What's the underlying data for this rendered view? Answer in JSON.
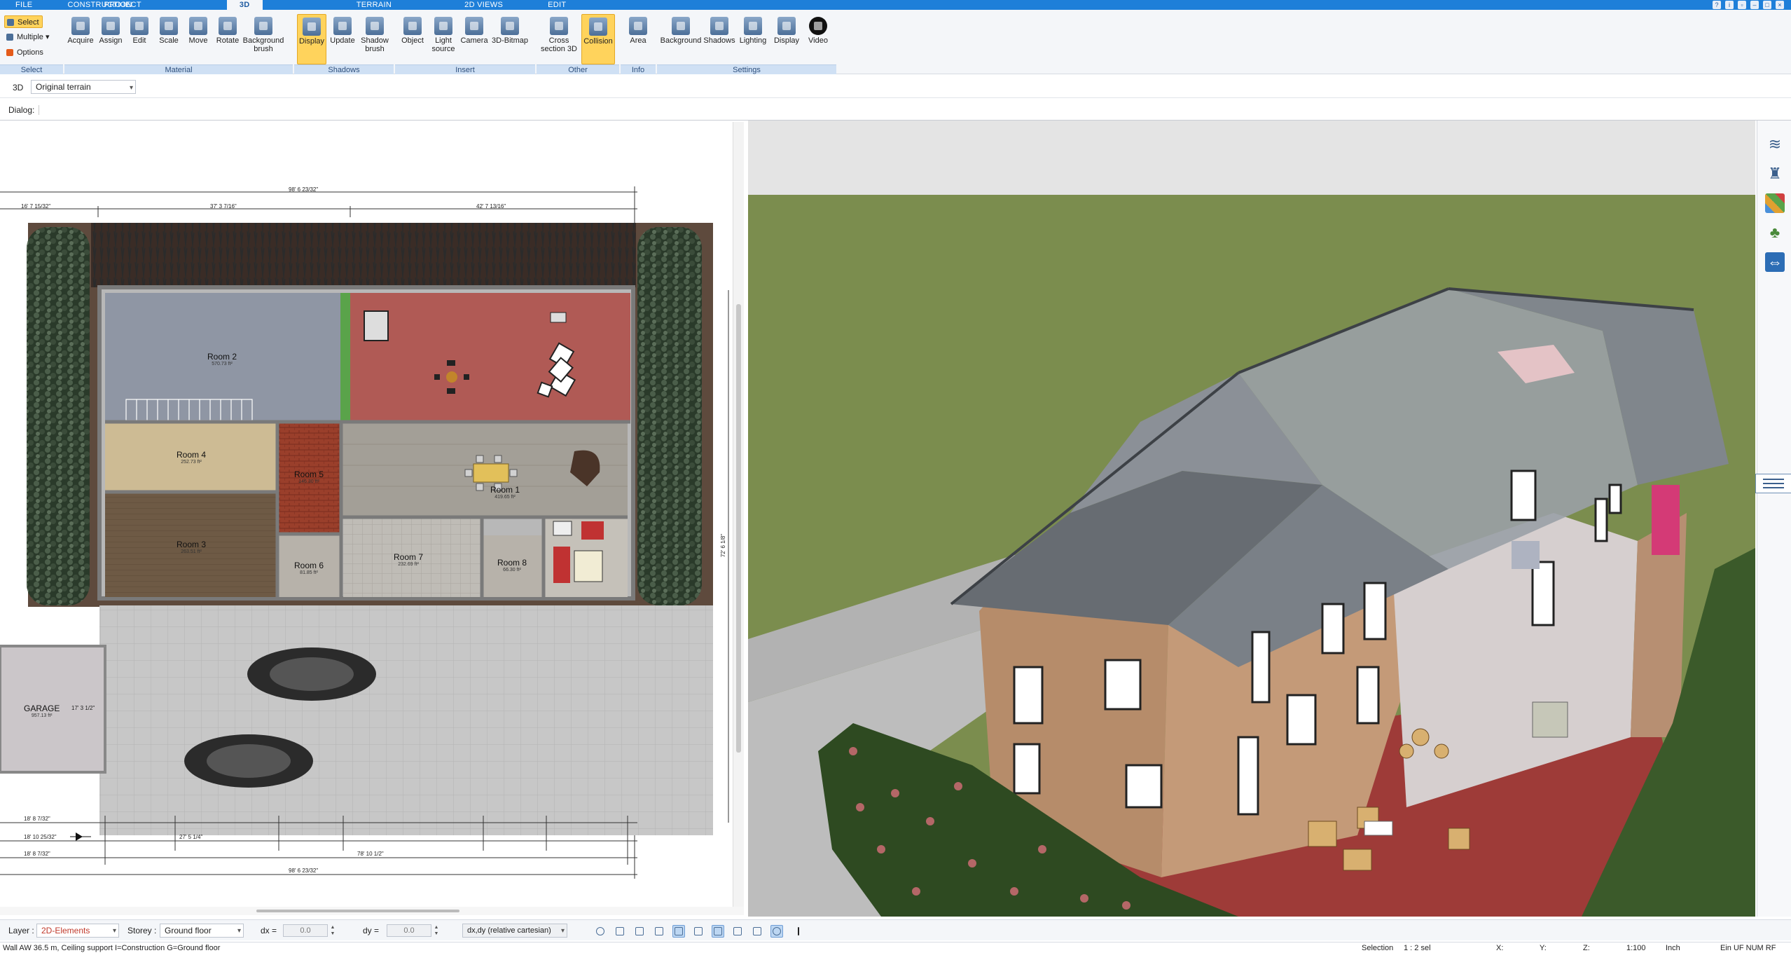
{
  "tabs": [
    "FILE",
    "PROJECT",
    "3D",
    "CONSTRUCTION",
    "TERRAIN",
    "2D VIEWS",
    "EDIT"
  ],
  "active_tab": "3D",
  "ribbon": {
    "select": {
      "label": "Select",
      "items": [
        "Select",
        "Multiple",
        "Options"
      ]
    },
    "material": {
      "label": "Material",
      "items": [
        "Acquire",
        "Assign",
        "Edit",
        "Scale",
        "Move",
        "Rotate",
        "Background brush"
      ]
    },
    "shadows": {
      "label": "Shadows",
      "items": [
        "Display",
        "Update",
        "Shadow brush"
      ]
    },
    "insert": {
      "label": "Insert",
      "items": [
        "Object",
        "Light source",
        "Camera",
        "3D-Bitmap"
      ]
    },
    "other": {
      "label": "Other",
      "items": [
        "Cross section 3D",
        "Collision"
      ]
    },
    "info": {
      "label": "Info",
      "items": [
        "Area"
      ]
    },
    "settings": {
      "label": "Settings",
      "items": [
        "Background",
        "Shadows",
        "Lighting",
        "Display",
        "Video"
      ]
    }
  },
  "view3d_label": "3D",
  "terrain_select": "Original terrain",
  "dialog_label": "Dialog:",
  "plan": {
    "rooms": [
      {
        "name": "Room 2",
        "area": "570.73 ft²"
      },
      {
        "name": "Room 4",
        "area": "252.73 ft²"
      },
      {
        "name": "Room 3",
        "area": "263.51 ft²"
      },
      {
        "name": "Room 5",
        "area": "146.30 ft²"
      },
      {
        "name": "Room 1",
        "area": "419.65 ft²"
      },
      {
        "name": "Room 6",
        "area": "81.85 ft²"
      },
      {
        "name": "Room 7",
        "area": "232.69 ft²"
      },
      {
        "name": "Room 8",
        "area": "66.30 ft²"
      },
      {
        "name": "GARAGE",
        "area": "957.13 ft²"
      }
    ],
    "dims": {
      "top_total": "98' 6 23/32\"",
      "top_left": "16' 7 15/32\"",
      "top_mid": "37' 3 7/16\"",
      "top_right": "42' 7 13/16\"",
      "bottom_total": "98' 6 23/32\"",
      "bottom_b": "78' 10 1/2\"",
      "bottom_left1": "18' 8 7/32\"",
      "bottom_left2": "18' 10 25/32\"",
      "bottom_left3": "18' 8 7/32\"",
      "bottom_mid": "27' 5 1/4\"",
      "side_right": "72' 6 1/8\"",
      "garage_dim": "17' 3 1/2\""
    }
  },
  "layerbar": {
    "layer_label": "Layer :",
    "layer_value": "2D-Elements",
    "storey_label": "Storey :",
    "storey_value": "Ground floor",
    "dx_label": "dx =",
    "dx_value": "0.0",
    "dy_label": "dy =",
    "dy_value": "0.0",
    "coord_mode": "dx,dy (relative cartesian)"
  },
  "status": {
    "left": "Wall AW 36.5 m, Ceiling support I=Construction G=Ground floor",
    "selection": "Selection",
    "sel_value": "1 : 2 sel",
    "x": "X:",
    "y": "Y:",
    "z": "Z:",
    "scale": "1:100",
    "unit": "Inch",
    "flags": "Ein   UF  NUM  RF"
  },
  "colors": {
    "accent": "#1e7fd9",
    "ribbon": "#f4f6f9",
    "active": "#ffd35c",
    "grass": "#7b8d4e",
    "patio": "#9e3b38"
  }
}
